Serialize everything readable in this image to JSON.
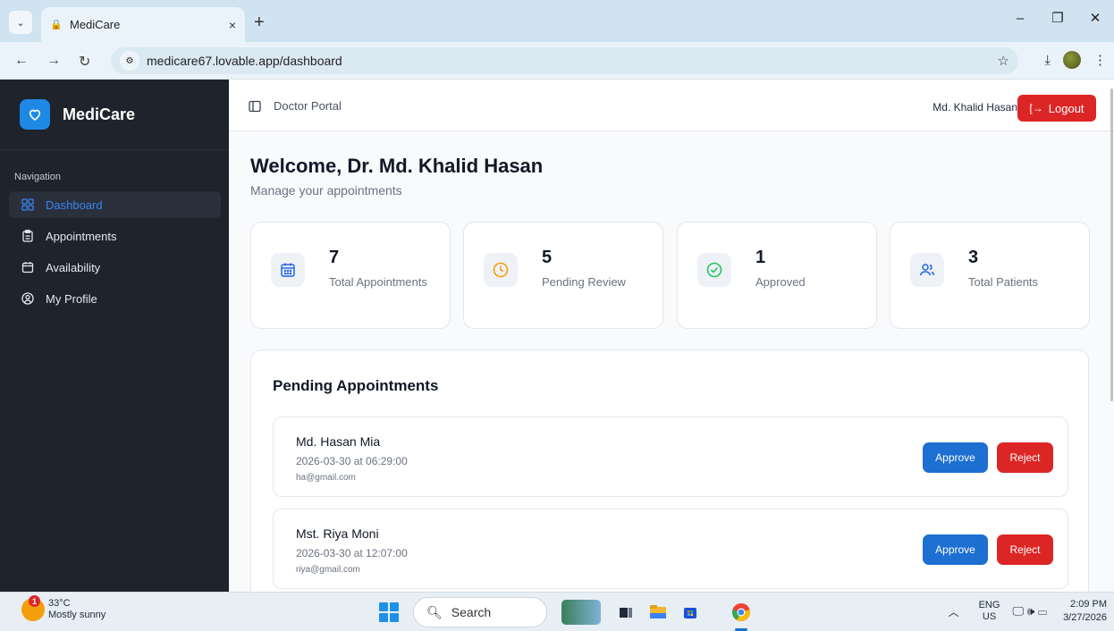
{
  "browser": {
    "tab_title": "MediCare",
    "tab_close": "×",
    "new_tab": "+",
    "url": "medicare67.lovable.app/dashboard",
    "window_controls": {
      "minimize": "–",
      "restore": "❐",
      "close": "✕"
    }
  },
  "sidebar": {
    "brand": "MediCare",
    "group_label": "Navigation",
    "items": [
      {
        "label": "Dashboard",
        "icon": "dashboard-icon",
        "active": true
      },
      {
        "label": "Appointments",
        "icon": "clipboard-icon",
        "active": false
      },
      {
        "label": "Availability",
        "icon": "calendar-icon",
        "active": false
      },
      {
        "label": "My Profile",
        "icon": "user-circle-icon",
        "active": false
      }
    ]
  },
  "header": {
    "portal_title": "Doctor Portal",
    "user_name": "Md. Khalid Hasan",
    "logout_label": "Logout"
  },
  "welcome": {
    "title": "Welcome, Dr. Md. Khalid Hasan",
    "subtitle": "Manage your appointments"
  },
  "stats": [
    {
      "value": "7",
      "label": "Total Appointments",
      "icon": "calendar-icon",
      "color": "#2563eb",
      "bg": "#eef2f7"
    },
    {
      "value": "5",
      "label": "Pending Review",
      "icon": "clock-icon",
      "color": "#f59e0b",
      "bg": "#eef2f7"
    },
    {
      "value": "1",
      "label": "Approved",
      "icon": "check-circle-icon",
      "color": "#22c55e",
      "bg": "#eef2f7"
    },
    {
      "value": "3",
      "label": "Total Patients",
      "icon": "users-icon",
      "color": "#2563eb",
      "bg": "#eef2f7"
    }
  ],
  "pending": {
    "title": "Pending Appointments",
    "approve_label": "Approve",
    "reject_label": "Reject",
    "items": [
      {
        "name": "Md. Hasan Mia",
        "datetime": "2026-03-30 at 06:29:00",
        "email": "ha@gmail.com"
      },
      {
        "name": "Mst. Riya Moni",
        "datetime": "2026-03-30 at 12:07:00",
        "email": "riya@gmail.com"
      }
    ]
  },
  "taskbar": {
    "weather_badge": "1",
    "temperature": "33°C",
    "weather": "Mostly sunny",
    "search": "Search",
    "lang": "ENG",
    "region": "US",
    "time": "2:09 PM",
    "date": "3/27/2026"
  },
  "colors": {
    "accent": "#1d6fd1",
    "danger": "#dc2626",
    "sidebar_bg": "#1e232c"
  }
}
